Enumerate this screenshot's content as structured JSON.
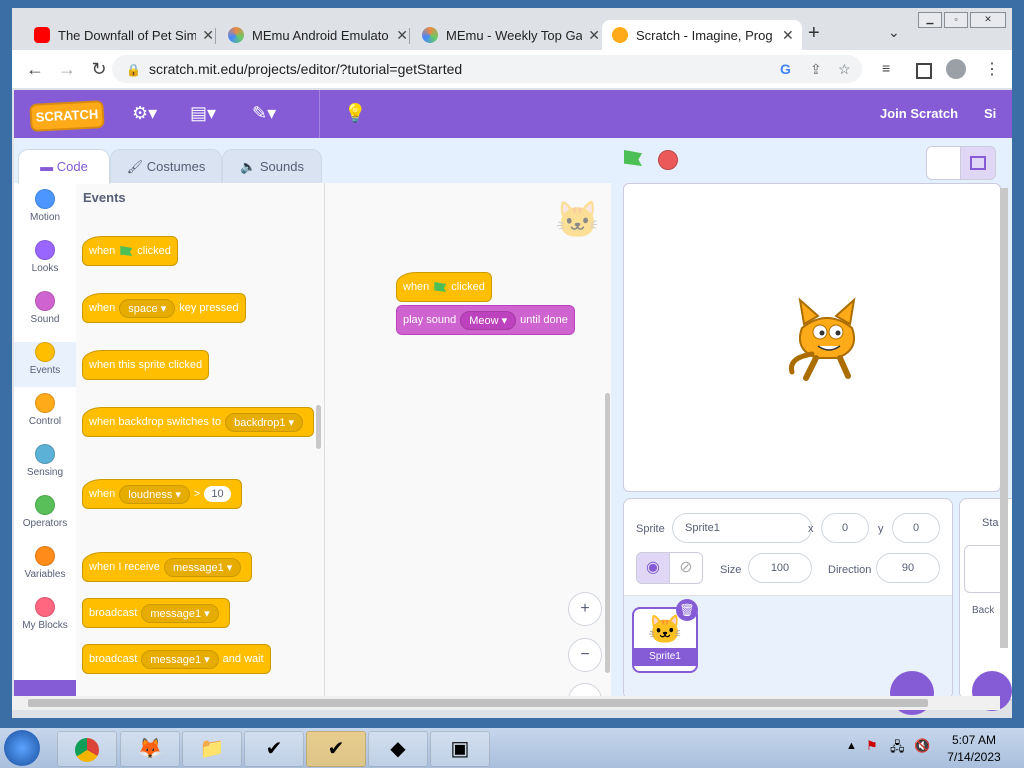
{
  "browser": {
    "tabs": [
      {
        "title": "The Downfall of Pet Sim",
        "active": false
      },
      {
        "title": "MEmu Android Emulato",
        "active": false
      },
      {
        "title": "MEmu - Weekly Top Gan",
        "active": false
      },
      {
        "title": "Scratch - Imagine, Prog",
        "active": true
      }
    ],
    "new_tab": "+",
    "url": "scratch.mit.edu/projects/editor/?tutorial=getStarted"
  },
  "menubar": {
    "logo": "SCRATCH",
    "join": "Join Scratch",
    "signin": "Si"
  },
  "editor_tabs": {
    "code": "Code",
    "costumes": "Costumes",
    "sounds": "Sounds"
  },
  "categories": [
    {
      "label": "Motion",
      "color": "#4c97ff"
    },
    {
      "label": "Looks",
      "color": "#9966ff"
    },
    {
      "label": "Sound",
      "color": "#cf63cf"
    },
    {
      "label": "Events",
      "color": "#ffbf00"
    },
    {
      "label": "Control",
      "color": "#ffab19"
    },
    {
      "label": "Sensing",
      "color": "#5cb1d6"
    },
    {
      "label": "Operators",
      "color": "#59c059"
    },
    {
      "label": "Variables",
      "color": "#ff8c1a"
    },
    {
      "label": "My Blocks",
      "color": "#ff6680"
    }
  ],
  "palette": {
    "heading": "Events",
    "flag_clicked": {
      "a": "when",
      "b": "clicked"
    },
    "key_pressed": {
      "a": "when",
      "key": "space",
      "b": "key pressed"
    },
    "sprite_clicked": "when this sprite clicked",
    "backdrop": {
      "a": "when backdrop switches to",
      "value": "backdrop1"
    },
    "loudness": {
      "a": "when",
      "value": "loudness",
      "op": ">",
      "num": "10"
    },
    "receive": {
      "a": "when I receive",
      "value": "message1"
    },
    "broadcast": {
      "a": "broadcast",
      "value": "message1"
    },
    "broadcast_wait": {
      "a": "broadcast",
      "value": "message1",
      "b": "and wait"
    }
  },
  "script": {
    "hat": {
      "a": "when",
      "b": "clicked"
    },
    "sound": {
      "a": "play sound",
      "value": "Meow",
      "b": "until done"
    }
  },
  "zoom": {
    "in": "+",
    "out": "−",
    "reset": "="
  },
  "sprite_info": {
    "sprite_label": "Sprite",
    "sprite_name": "Sprite1",
    "x_label": "x",
    "x": "0",
    "y_label": "y",
    "y": "0",
    "size_label": "Size",
    "size": "100",
    "direction_label": "Direction",
    "direction": "90",
    "thumb_name": "Sprite1"
  },
  "stage_side": {
    "label1": "Sta",
    "label2": "Back"
  },
  "taskbar": {
    "time": "5:07 AM",
    "date": "7/14/2023"
  },
  "colors": {
    "scratch_purple": "#855cd6",
    "events": "#ffbf00",
    "sound": "#cf63cf"
  }
}
